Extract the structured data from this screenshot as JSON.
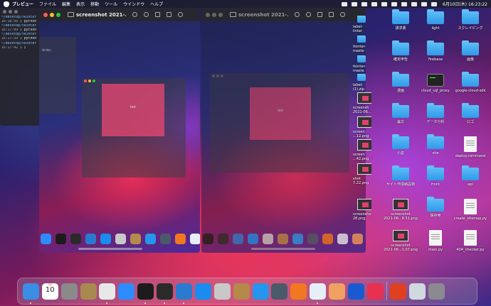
{
  "menubar": {
    "app": "プレビュー",
    "items": [
      "ファイル",
      "編集",
      "表示",
      "移動",
      "ツール",
      "ウインドウ",
      "ヘルプ"
    ],
    "clock": "6月10日(木)  16:23:22"
  },
  "terminal": {
    "lines": [
      {
        "path": "~/desktop/tkinter",
        "time": "16:16:56",
        "cmd": "python"
      },
      {
        "path": "~/desktop/tkinter",
        "time": "16:17:09",
        "cmd": "python"
      },
      {
        "path": "~/desktop/tkinter",
        "time": "16:17:39",
        "cmd": "python"
      },
      {
        "path": "~/desktop/tkinter",
        "time": "16:17:42",
        "cmd": ""
      }
    ]
  },
  "preview1": {
    "title": "screenshot 2021-...",
    "tk_button_text": "test",
    "ghost_text": "tk  tkin"
  },
  "preview2": {
    "title": "screenshot 2021-...",
    "tk_button_text": "test"
  },
  "desktop_edge_labels": [
    "label-\nlinter",
    "tkinter-\nmaste",
    "tkinter-\nmaste",
    "label-\n(1).zip",
    "screensh\n2021-06...03.png",
    "screen\n...12.png",
    "screen\n...42.png",
    "shot\n7.22.png",
    "screenshot\n28.png"
  ],
  "desktop": [
    {
      "col": 0,
      "label": "請求書",
      "type": "folder"
    },
    {
      "col": 1,
      "label": "light",
      "type": "folder"
    },
    {
      "col": 2,
      "label": "スクレイピング",
      "type": "folder"
    },
    {
      "col": 0,
      "label": "確定申告",
      "type": "folder"
    },
    {
      "col": 1,
      "label": "firebase",
      "type": "folder"
    },
    {
      "col": 2,
      "label": "画像",
      "type": "folder"
    },
    {
      "col": 0,
      "label": "漫画",
      "type": "folder"
    },
    {
      "col": 1,
      "label": "cloud_sql_proxy",
      "type": "dark"
    },
    {
      "col": 2,
      "label": "google-cloud-sdk",
      "type": "folder"
    },
    {
      "col": 0,
      "label": "論文",
      "type": "folder"
    },
    {
      "col": 1,
      "label": "データ分析",
      "type": "folder"
    },
    {
      "col": 2,
      "label": "ロゴ",
      "type": "folder"
    },
    {
      "col": 0,
      "label": "小説",
      "type": "folder"
    },
    {
      "col": 1,
      "label": "site",
      "type": "folder"
    },
    {
      "col": 2,
      "label": "deploy.command",
      "type": "doc"
    },
    {
      "col": 0,
      "label": "サイト作成納品物",
      "type": "folder"
    },
    {
      "col": 1,
      "label": "front",
      "type": "folder"
    },
    {
      "col": 2,
      "label": "api",
      "type": "folder"
    },
    {
      "col": 0,
      "label": "screenshot\n2021-06...8.51.png",
      "type": "thumb"
    },
    {
      "col": 1,
      "label": "保存用",
      "type": "folder"
    },
    {
      "col": 2,
      "label": "create_sitemap.py",
      "type": "doc"
    },
    {
      "col": 0,
      "label": "screenshot\n2021-06...1.07.png",
      "type": "thumb"
    },
    {
      "col": 1,
      "label": "main.py",
      "type": "doc"
    },
    {
      "col": 2,
      "label": "404_checker.py",
      "type": "doc"
    }
  ],
  "dock": {
    "calendar_month": "6月",
    "calendar_day": "10",
    "apps": [
      {
        "name": "finder-icon",
        "color": "#3a8ee6",
        "dot": true
      },
      {
        "name": "calendar-icon",
        "color": "#ffffff",
        "dot": false
      },
      {
        "name": "system-preferences-icon",
        "color": "#8a8a8a",
        "dot": false
      },
      {
        "name": "app-bag-icon",
        "color": "#a88a50",
        "dot": false
      },
      {
        "name": "chrome-icon",
        "color": "#e8e8e8",
        "dot": true
      },
      {
        "name": "zoom-icon",
        "color": "#2d8cff",
        "dot": false
      },
      {
        "name": "iterm-icon",
        "color": "#1c1c1c",
        "dot": true
      },
      {
        "name": "terminal-icon",
        "color": "#2a2a2a",
        "dot": true
      },
      {
        "name": "vscode-icon",
        "color": "#2a7bd0",
        "dot": true
      },
      {
        "name": "safari-icon",
        "color": "#1a8cf0",
        "dot": false
      },
      {
        "name": "sequel-icon",
        "color": "#c8c8c8",
        "dot": false
      },
      {
        "name": "stuffit-icon",
        "color": "#b4894a",
        "dot": false
      },
      {
        "name": "docker-icon",
        "color": "#2496ed",
        "dot": false
      },
      {
        "name": "quicktime-icon",
        "color": "#4a5a6a",
        "dot": false
      },
      {
        "name": "sourcetree-icon",
        "color": "#f07820",
        "dot": false
      },
      {
        "name": "preview-icon",
        "color": "#e6eef8",
        "dot": true
      },
      {
        "name": "photos-app-icon",
        "color": "#f0a060",
        "dot": false
      },
      {
        "name": "infinity-icon",
        "color": "#1a5ad0",
        "dot": false
      },
      {
        "name": "clock-app-icon",
        "color": "#e83050",
        "dot": false
      }
    ],
    "trailing": [
      {
        "name": "activity-icon",
        "color": "#e04020"
      },
      {
        "name": "image-stack-icon",
        "color": "#d0d8e0"
      },
      {
        "name": "trash-icon",
        "color": "#8a8a90"
      }
    ]
  }
}
